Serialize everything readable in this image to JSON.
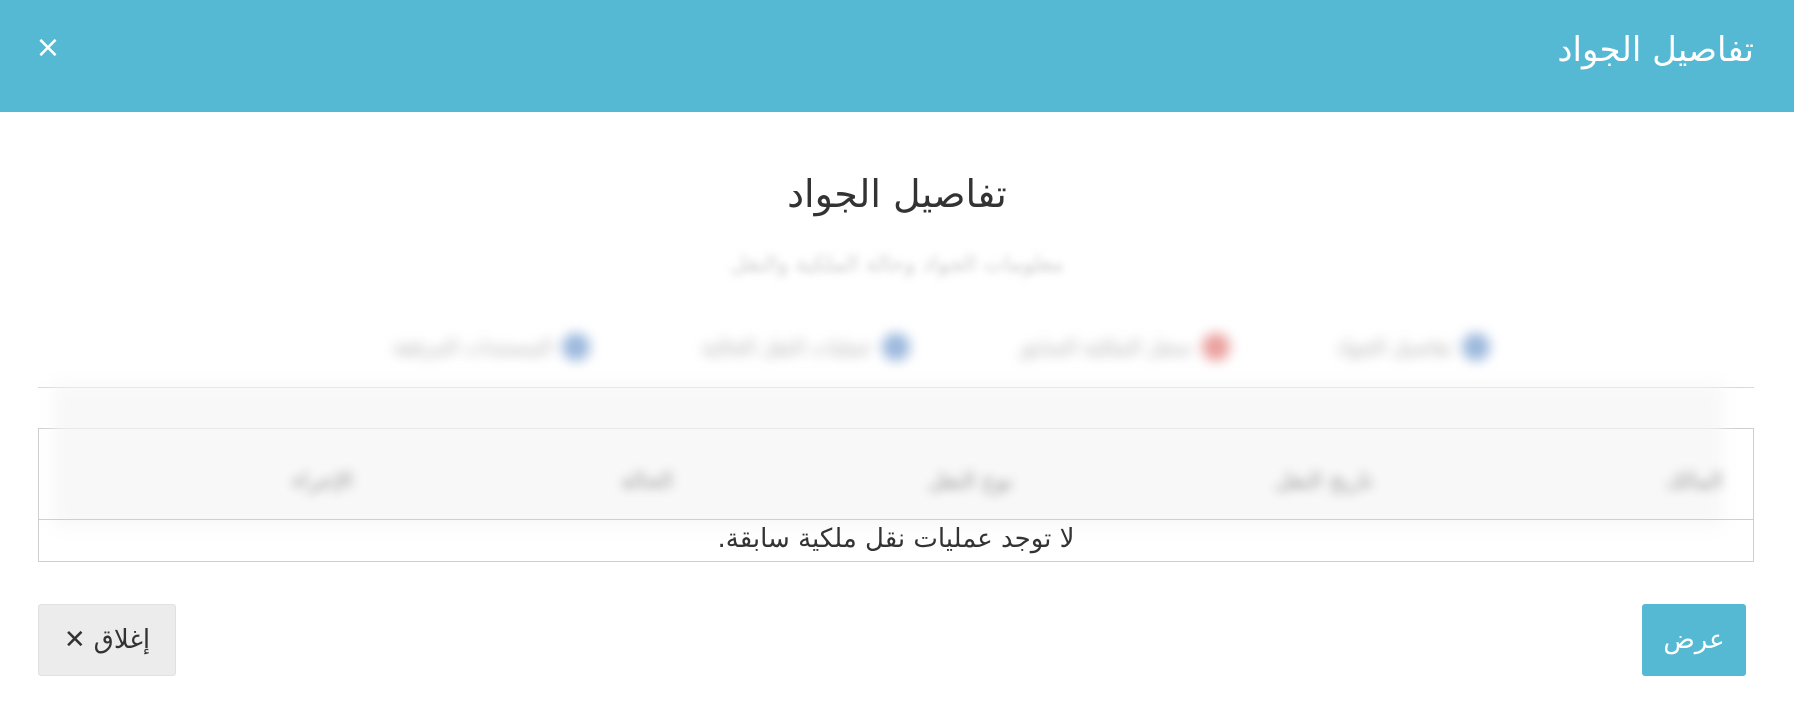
{
  "header": {
    "title": "تفاصيل الجواد",
    "close_icon": "×"
  },
  "body": {
    "title": "تفاصيل الجواد",
    "subtitle": "معلومات الجواد وحالة الملكية والنقل"
  },
  "tabs": [
    {
      "label": "تفاصيل الجواد",
      "icon": "horse-icon",
      "color": "#4a7fc1"
    },
    {
      "label": "سجل الملكية السابق",
      "icon": "history-icon",
      "color": "#d9534f"
    },
    {
      "label": "عمليات النقل الحالية",
      "icon": "transfer-icon",
      "color": "#4a7fc1"
    },
    {
      "label": "المستندات المرفقة",
      "icon": "document-icon",
      "color": "#4a7fc1"
    }
  ],
  "table": {
    "headers": [
      "المالك",
      "تاريخ النقل",
      "نوع النقل",
      "الحالة",
      "الإجراء"
    ],
    "empty_message": "لا توجد عمليات نقل ملكية سابقة."
  },
  "footer": {
    "close_label": "إغلاق",
    "close_icon": "✕",
    "view_label": "عرض"
  },
  "colors": {
    "header_bg": "#56b9d4",
    "primary_button": "#56b9d4",
    "secondary_button": "#ececec"
  }
}
